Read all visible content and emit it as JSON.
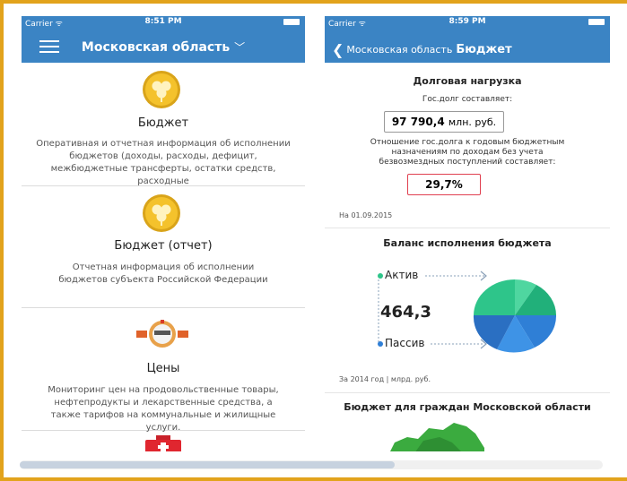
{
  "left_phone": {
    "status": {
      "carrier": "Carrier ᯤ",
      "time": "8:51 PM"
    },
    "navbar": {
      "title": "Московская область",
      "chevron": "﹀",
      "menu_icon": "hamburger-icon"
    },
    "items": [
      {
        "title": "Бюджет",
        "description": "Оперативная и отчетная информация об исполнении бюджетов (доходы, расходы, дефицит, межбюджетные трансферты, остатки средств, расходные",
        "icon": "clover-coin-icon"
      },
      {
        "title": "Бюджет (отчет)",
        "description": "Отчетная информация об исполнении бюджетов субъекта Российской Федерации",
        "icon": "clover-coin-icon"
      },
      {
        "title": "Цены",
        "description": "Мониторинг цен на продовольственные товары, нефтепродукты и лекарственные средства, а также тарифов на коммунальные и жилищные услуги.",
        "icon": "water-meter-icon"
      }
    ]
  },
  "right_phone": {
    "status": {
      "carrier": "Carrier ᯤ",
      "time": "8:59 PM"
    },
    "navbar": {
      "back_label": "Московская область",
      "title": "Бюджет"
    },
    "debt": {
      "title": "Долговая нагрузка",
      "label": "Гос.долг составляет:",
      "value": "97 790,4",
      "unit": "млн. руб.",
      "ratio_label": "Отношение гос.долга к годовым бюджетным назначениям по доходам без учета безвозмездных поступлений составляет:",
      "ratio_value": "29,7%",
      "date": "На 01.09.2015"
    },
    "balance": {
      "title": "Баланс исполнения бюджета",
      "active_label": "Актив",
      "passive_label": "Пассив",
      "value": "464,3",
      "note": "За 2014 год  |  млрд. руб.",
      "colors": {
        "active": "#2ec58a",
        "passive": "#2f7fd6"
      }
    },
    "citizens": {
      "title": "Бюджет для граждан Московской области"
    }
  }
}
